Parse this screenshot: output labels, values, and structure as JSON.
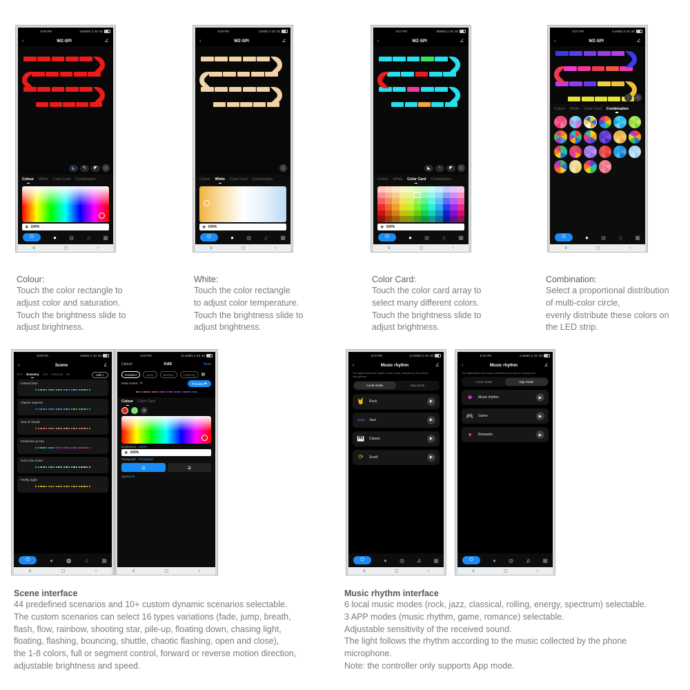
{
  "phones": {
    "colour": {
      "status": {
        "time": "6:09 PM",
        "info": "164KB/s 2 4G 4G"
      },
      "title": "WZ-SPI",
      "back_icon": "chevron-left-icon",
      "edit_icon": "pencil-icon",
      "tabs": [
        {
          "label": "Colour",
          "active": true
        },
        {
          "label": "White",
          "active": false
        },
        {
          "label": "Color Card",
          "active": false
        },
        {
          "label": "Combination",
          "active": false
        }
      ],
      "brightness": "100%",
      "strip_color": "#ee1b1b",
      "tools": [
        "paint-bucket-icon",
        "brush-icon",
        "eraser-icon",
        "palette-icon"
      ],
      "dock": [
        "power-icon",
        "bulb-icon",
        "palette-icon",
        "music-icon",
        "grid-icon"
      ],
      "nav": [
        "menu-icon",
        "home-icon",
        "back-icon"
      ]
    },
    "white": {
      "status": {
        "time": "6:09 PM",
        "info": "12KB/s 2 4G 4G"
      },
      "title": "WZ-SPI",
      "tabs": [
        {
          "label": "Colour",
          "active": false
        },
        {
          "label": "White",
          "active": true
        },
        {
          "label": "Color Card",
          "active": false
        },
        {
          "label": "Combination",
          "active": false
        }
      ],
      "brightness": "100%",
      "strip_color": "#f2d3a6"
    },
    "colorcard": {
      "status": {
        "time": "6:07 PM",
        "info": "60KB/s 2 4G 4G"
      },
      "title": "WZ-SPI",
      "tabs": [
        {
          "label": "Colour",
          "active": false
        },
        {
          "label": "White",
          "active": false
        },
        {
          "label": "Color Card",
          "active": true
        },
        {
          "label": "Combination",
          "active": false
        }
      ],
      "brightness": "100%"
    },
    "combination": {
      "status": {
        "time": "6:07 PM",
        "info": "6.4KB/s 2 4G 4G"
      },
      "title": "WZ-SPI",
      "tabs": [
        {
          "label": "Colour",
          "active": false
        },
        {
          "label": "White",
          "active": false
        },
        {
          "label": "Color Card",
          "active": false
        },
        {
          "label": "Combination",
          "active": true
        }
      ]
    },
    "scene": {
      "status": {
        "time": "6:09 PM",
        "info": "74KB/s 2 4G 4G"
      },
      "title": "Scene",
      "chips": [
        {
          "label": "DIY",
          "active": false
        },
        {
          "label": "Scenery",
          "active": true
        },
        {
          "label": "Life",
          "active": false
        },
        {
          "label": "Festival",
          "active": false
        },
        {
          "label": "Mi",
          "active": false
        }
      ],
      "add_label": "Add +",
      "scenes": [
        {
          "name": "Iceland blue"
        },
        {
          "name": "Glacier express"
        },
        {
          "name": "Sea of clouds"
        },
        {
          "name": "Fireworks at sea"
        },
        {
          "name": "Hut in the snow"
        },
        {
          "name": "Firefly night"
        }
      ]
    },
    "editor": {
      "status": {
        "time": "6:10 PM",
        "info": "11.2KB/s 2 4G 4G"
      },
      "cancel": "Cancel",
      "title": "Add",
      "save": "Save",
      "modes": [
        {
          "label": "Gradient",
          "active": true
        },
        {
          "label": "Jump",
          "active": false
        },
        {
          "label": "Breathe",
          "active": false
        },
        {
          "label": "Flashing",
          "active": false
        }
      ],
      "list_icon": "list-icon",
      "scene_name": "New scene",
      "preview_label": "Preview",
      "subtabs": [
        {
          "label": "Colour",
          "active": true
        },
        {
          "label": "Color Card",
          "active": false
        }
      ],
      "swatches": [
        "#e51d1d",
        "#7ce07c"
      ],
      "add_swatch": "+",
      "brightness_label": "Brightness",
      "brightness_value": "100%",
      "brightness_field": "100%",
      "paragraph_label": "Paragraph",
      "paragraph_value": "Paragraph",
      "dir_forward": "⊇",
      "dir_reverse": "⊋",
      "speed_label": "Speed",
      "speed_value": "50"
    },
    "music_local": {
      "status": {
        "time": "6:10 PM",
        "info": "12.3KB/s 2 4G 4G"
      },
      "title": "Music rhythm",
      "hint": "The lights follow the rhythm of the music collected by the device microphone",
      "switch": [
        {
          "label": "Local mode",
          "active": true
        },
        {
          "label": "App mode",
          "active": false
        }
      ],
      "rows": [
        {
          "name": "Rock",
          "icon": "rock-hand-icon",
          "glyph": "🤘",
          "color": "#e8a07a"
        },
        {
          "name": "Jazz",
          "icon": "jazz-text-icon",
          "glyph": "JAZZ",
          "color": "#9a4bd6"
        },
        {
          "name": "Classic",
          "icon": "piano-icon",
          "glyph": "🎹",
          "color": "#ffffff"
        },
        {
          "name": "Scroll",
          "icon": "refresh-icon",
          "glyph": "⟳",
          "color": "#e8a81e"
        }
      ],
      "play_icon": "play-icon"
    },
    "music_app": {
      "status": {
        "time": "6:10 PM",
        "info": "5.3KB/s 2 4G 4G"
      },
      "title": "Music rhythm",
      "hint": "The lights follow the music collected by the phone microphone",
      "switch": [
        {
          "label": "Local mode",
          "active": false
        },
        {
          "label": "App mode",
          "active": true
        }
      ],
      "rows": [
        {
          "name": "Music rhythm",
          "icon": "music-rhythm-icon",
          "glyph": "✹",
          "color": "#d93ad9"
        },
        {
          "name": "Game",
          "icon": "gamepad-icon",
          "glyph": "🎮",
          "color": "#ffffff"
        },
        {
          "name": "Romantic",
          "icon": "heart-icon",
          "glyph": "♥",
          "color": "#ef4060"
        }
      ],
      "play_icon": "play-icon"
    }
  },
  "captions": {
    "colour": {
      "heading": "Colour:",
      "body": "Touch the color rectangle to\nadjust color and saturation.\nTouch the brightness slide to\nadjust brightness."
    },
    "white": {
      "heading": "White:",
      "body": "Touch the color rectangle\nto adjust color temperature.\nTouch the brightness slide to\nadjust brightness."
    },
    "colorcard": {
      "heading": "Color Card:",
      "body": "Touch the color card array to\nselect many different colors.\nTouch the brightness slide to\nadjust brightness."
    },
    "combination": {
      "heading": "Combination:",
      "body": "Select a proportional distribution\nof multi-color circle,\nevenly distribute these colors on\nthe LED strip."
    },
    "scene": {
      "heading": "Scene interface",
      "body": "44 predefined scenarios and 10+ custom dynamic scenarios selectable.\nThe custom scenarios can select 16 types variations (fade, jump, breath,\nflash, flow, rainbow, shooting star, pile-up, floating down, chasing light,\nfloating, flashing, bouncing, shuttle, chaotic flashing, open and close),\nthe 1-8 colors, full or segment control, forward or reverse motion direction,\nadjustable brightness and speed."
    },
    "music": {
      "heading": "Music rhythm interface",
      "body": "6 local music modes (rock, jazz, classical, rolling, energy, spectrum) selectable.\n3 APP modes (music rhythm, game, romance) selectable.\nAdjustable sensitivity of the received sound.\nThe light follows the rhythm according to the music collected by the phone\nmicrophone.\nNote: the controller only supports App mode."
    }
  }
}
